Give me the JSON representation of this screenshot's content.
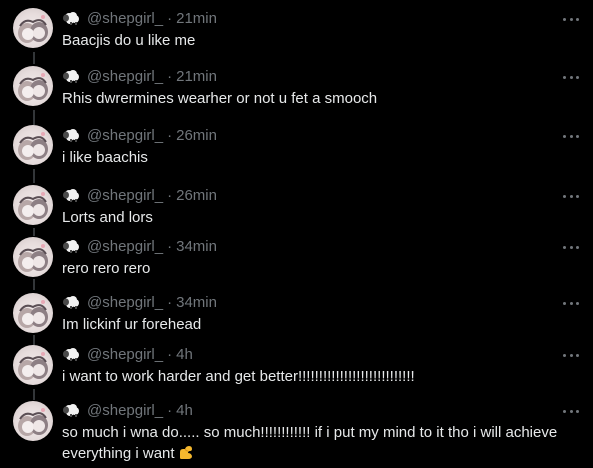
{
  "thread": {
    "posts": [
      {
        "handle": "@shepgirl_",
        "separator": "·",
        "time": "21min",
        "text": "Baacjis do u like me"
      },
      {
        "handle": "@shepgirl_",
        "separator": "·",
        "time": "21min",
        "text": "Rhis dwrermines wearher or not u fet a smooch"
      },
      {
        "handle": "@shepgirl_",
        "separator": "·",
        "time": "26min",
        "text": "i like baachis"
      },
      {
        "handle": "@shepgirl_",
        "separator": "·",
        "time": "26min",
        "text": "Lorts and lors"
      },
      {
        "handle": "@shepgirl_",
        "separator": "·",
        "time": "34min",
        "text": "rero rero rero"
      },
      {
        "handle": "@shepgirl_",
        "separator": "·",
        "time": "34min",
        "text": "Im lickinf ur forehead"
      },
      {
        "handle": "@shepgirl_",
        "separator": "·",
        "time": "4h",
        "text": "i want to work harder and get better!!!!!!!!!!!!!!!!!!!!!!!!!!!!"
      },
      {
        "handle": "@shepgirl_",
        "separator": "·",
        "time": "4h",
        "text": "so much i wna do..... so much!!!!!!!!!!!! if i put my mind to it tho i will achieve everything i want"
      }
    ]
  },
  "icons": {
    "name_badge": "sheep-emoji-icon",
    "more": "more-options-icon",
    "trailing_emoji": "flexed-biceps-emoji-icon"
  },
  "colors": {
    "background": "#000000",
    "text": "#e7e9ea",
    "secondary": "#71767b",
    "rail": "#333639"
  }
}
